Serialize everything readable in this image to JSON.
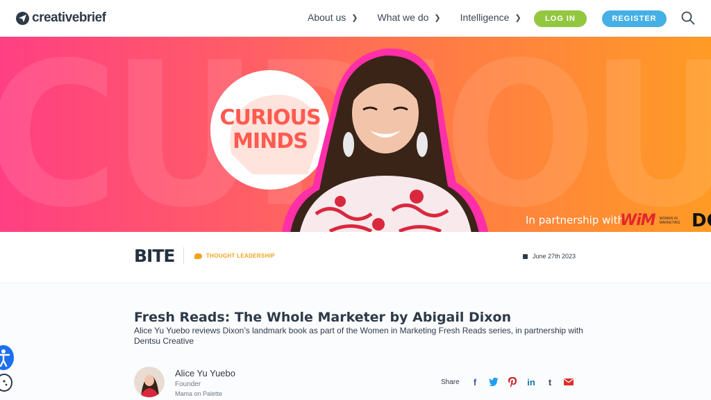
{
  "header": {
    "logo_text": "creativebrief",
    "nav": [
      {
        "label": "About us"
      },
      {
        "label": "What we do"
      },
      {
        "label": "Intelligence"
      }
    ],
    "login_label": "LOG IN",
    "register_label": "REGISTER"
  },
  "hero": {
    "background_word": "CURIOUS MINDS",
    "badge_lines": [
      "CURIOUS",
      "MINDS"
    ],
    "partnership_text": "In partnership with",
    "wim_mark": "WiM",
    "wim_sub": "WOMEN IN MARKETING",
    "dc_mark": "DC",
    "colors": {
      "left": "#ff3f82",
      "right": "#ff9b25"
    }
  },
  "strip": {
    "brand": "BITE",
    "category": "THOUGHT LEADERSHIP",
    "date": "June 27th 2023"
  },
  "article": {
    "title": "Fresh Reads: The Whole Marketer by Abigail Dixon",
    "subtitle": "Alice Yu Yuebo reviews Dixon’s landmark book as part of the Women in Marketing Fresh Reads series, in partnership with Dentsu Creative",
    "author": {
      "name": "Alice Yu Yuebo",
      "role": "Founder",
      "org": "Mama on Palette"
    },
    "share_label": "Share",
    "share_icons": [
      "facebook-icon",
      "twitter-icon",
      "pinterest-icon",
      "linkedin-icon",
      "tumblr-icon",
      "email-icon"
    ]
  }
}
